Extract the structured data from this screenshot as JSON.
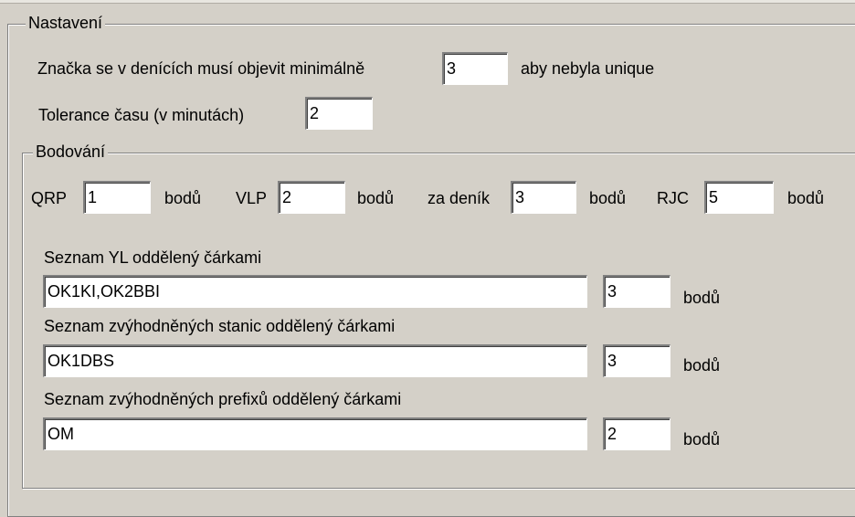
{
  "settings": {
    "legend": "Nastavení",
    "min_occurrence_label": "Značka se v denících musí objevit minimálně",
    "min_occurrence_value": "3",
    "min_occurrence_suffix": "aby nebyla unique",
    "time_tolerance_label": "Tolerance času (v minutách)",
    "time_tolerance_value": "2"
  },
  "scoring": {
    "legend": "Bodování",
    "qrp_label": "QRP",
    "qrp_value": "1",
    "vlp_label": "VLP",
    "vlp_value": "2",
    "log_label": "za deník",
    "log_value": "3",
    "rjc_label": "RJC",
    "rjc_value": "5",
    "points_unit": "bodů",
    "yl": {
      "label": "Seznam YL oddělený čárkami",
      "list": "OK1KI,OK2BBI",
      "points": "3"
    },
    "stations": {
      "label": "Seznam zvýhodněných stanic oddělený čárkami",
      "list": "OK1DBS",
      "points": "3"
    },
    "prefixes": {
      "label": "Seznam zvýhodněných prefixů oddělený čárkami",
      "list": "OM",
      "points": "2"
    }
  }
}
